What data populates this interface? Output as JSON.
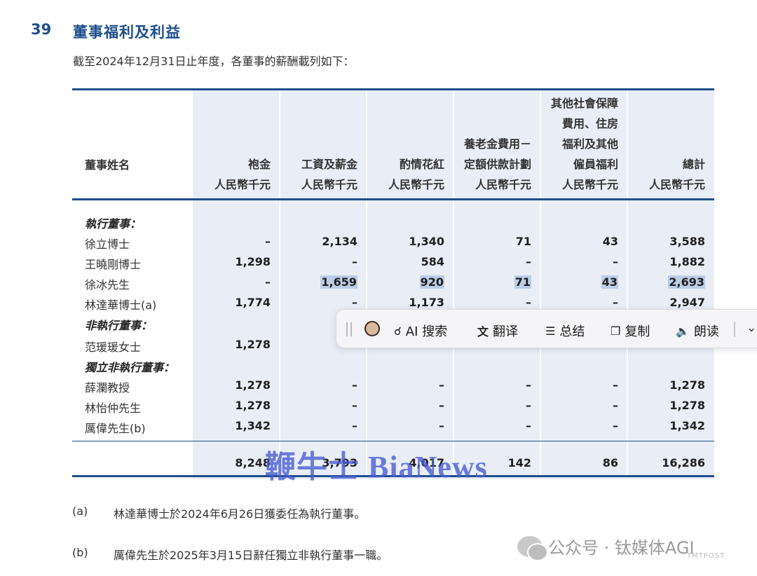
{
  "section": {
    "number": "39",
    "title": "董事福利及利益"
  },
  "intro": "截至2024年12月31日止年度，各董事的薪酬載列如下：",
  "table": {
    "name_header": "董事姓名",
    "columns": [
      {
        "lines": [
          "",
          "",
          "",
          "袍金",
          "人民幣千元"
        ]
      },
      {
        "lines": [
          "",
          "",
          "",
          "工資及薪金",
          "人民幣千元"
        ]
      },
      {
        "lines": [
          "",
          "",
          "",
          "酌情花紅",
          "人民幣千元"
        ]
      },
      {
        "lines": [
          "",
          "",
          "養老金費用－",
          "定額供款計劃",
          "人民幣千元"
        ]
      },
      {
        "lines": [
          "其他社會保障",
          "費用、住房",
          "福利及其他",
          "僱員福利",
          "人民幣千元"
        ]
      },
      {
        "lines": [
          "",
          "",
          "",
          "總計",
          "人民幣千元"
        ]
      }
    ],
    "groups": {
      "executive": "執行董事：",
      "non_executive": "非執行董事：",
      "independent": "獨立非執行董事："
    },
    "rows": {
      "xu_li": {
        "name": "徐立博士",
        "values": [
          "–",
          "2,134",
          "1,340",
          "71",
          "43",
          "3,588"
        ]
      },
      "wang_xiaogang": {
        "name": "王曉剛博士",
        "values": [
          "1,298",
          "–",
          "584",
          "–",
          "–",
          "1,882"
        ]
      },
      "xu_bing": {
        "name": "徐冰先生",
        "values": [
          "–",
          "1,659",
          "920",
          "71",
          "43",
          "2,693"
        ]
      },
      "lin_dahua": {
        "name": "林達華博士(a)",
        "values": [
          "1,774",
          "–",
          "1,173",
          "–",
          "–",
          "2,947"
        ]
      },
      "fan_yuanyuan": {
        "name": "范瑗瑗女士",
        "values": [
          "1,278",
          "",
          "",
          "",
          "",
          ""
        ]
      },
      "xue_lan": {
        "name": "薛瀾教授",
        "values": [
          "1,278",
          "–",
          "–",
          "–",
          "–",
          "1,278"
        ]
      },
      "lin_yizhong": {
        "name": "林怡仲先生",
        "values": [
          "1,278",
          "–",
          "–",
          "–",
          "–",
          "1,278"
        ]
      },
      "li_wei": {
        "name": "厲偉先生(b)",
        "values": [
          "1,342",
          "–",
          "–",
          "–",
          "–",
          "1,342"
        ]
      }
    },
    "totals": [
      "8,248",
      "3,793",
      "4,017",
      "142",
      "86",
      "16,286"
    ]
  },
  "footnotes": [
    {
      "mark": "(a)",
      "text": "林達華博士於2024年6月26日獲委任為執行董事。"
    },
    {
      "mark": "(b)",
      "text": "厲偉先生於2025年3月15日辭任獨立非執行董事一職。"
    }
  ],
  "popup": {
    "ai_search": "AI 搜索",
    "translate": "翻译",
    "summary": "总结",
    "copy": "复制",
    "read_aloud": "朗读"
  },
  "watermark": "鞭牛士 BiaNews",
  "wechat": {
    "text": "公众号 · 钛媒体AGI",
    "sub": "TMTPOST"
  }
}
